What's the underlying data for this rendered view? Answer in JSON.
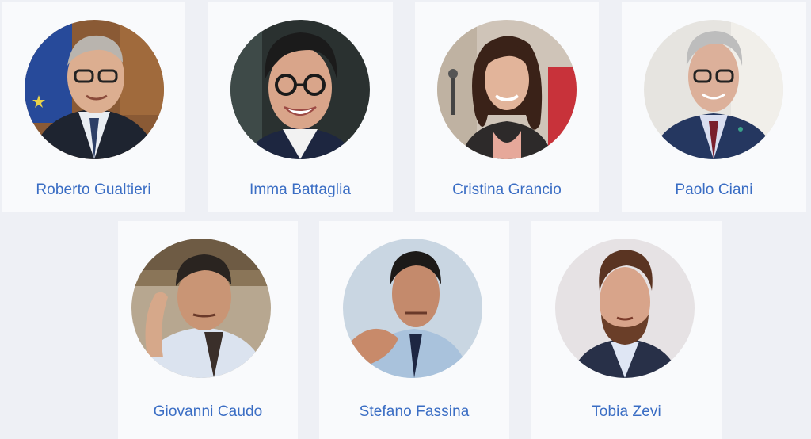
{
  "people": [
    {
      "name": "Roberto Gualtieri",
      "photo": "portrait-roberto-gualtieri"
    },
    {
      "name": "Imma Battaglia",
      "photo": "portrait-imma-battaglia"
    },
    {
      "name": "Cristina Grancio",
      "photo": "portrait-cristina-grancio"
    },
    {
      "name": "Paolo Ciani",
      "photo": "portrait-paolo-ciani"
    },
    {
      "name": "Giovanni Caudo",
      "photo": "portrait-giovanni-caudo"
    },
    {
      "name": "Stefano Fassina",
      "photo": "portrait-stefano-fassina"
    },
    {
      "name": "Tobia Zevi",
      "photo": "portrait-tobia-zevi"
    }
  ],
  "colors": {
    "page_background": "#eef0f5",
    "card_background": "#f9fafc",
    "name_link": "#3a6dc4"
  }
}
